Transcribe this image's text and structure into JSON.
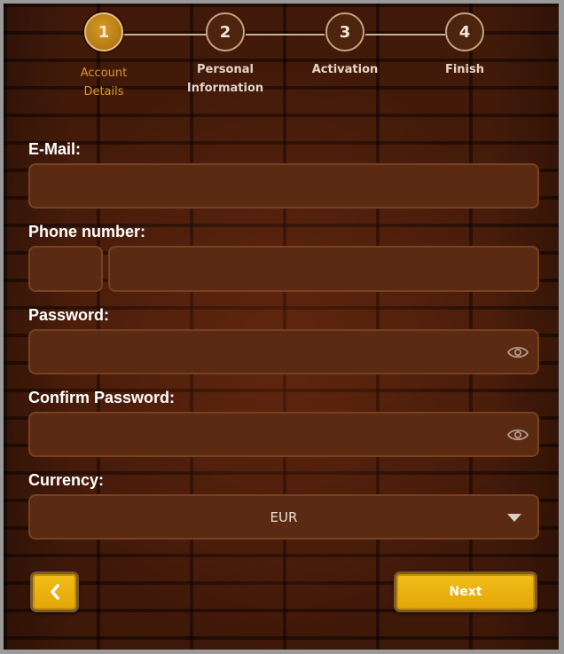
{
  "steps": [
    {
      "number": "1",
      "label_line1": "Account",
      "label_line2": "Details",
      "active": true
    },
    {
      "number": "2",
      "label_line1": "Personal",
      "label_line2": "Information",
      "active": false
    },
    {
      "number": "3",
      "label_line1": "Activation",
      "label_line2": "",
      "active": false
    },
    {
      "number": "4",
      "label_line1": "Finish",
      "label_line2": "",
      "active": false
    }
  ],
  "form": {
    "email_label": "E-Mail:",
    "email_value": "",
    "phone_label": "Phone number:",
    "phone_code_value": "",
    "phone_number_value": "",
    "password_label": "Password:",
    "password_value": "",
    "confirm_password_label": "Confirm Password:",
    "confirm_password_value": "",
    "currency_label": "Currency:",
    "currency_value": "EUR"
  },
  "buttons": {
    "back_icon": "chevron-left-icon",
    "next_label": "Next"
  },
  "colors": {
    "accent": "#e8ad0e",
    "active_step": "#c2861b",
    "input_bg": "#5a2a12",
    "background": "#3b1708"
  }
}
